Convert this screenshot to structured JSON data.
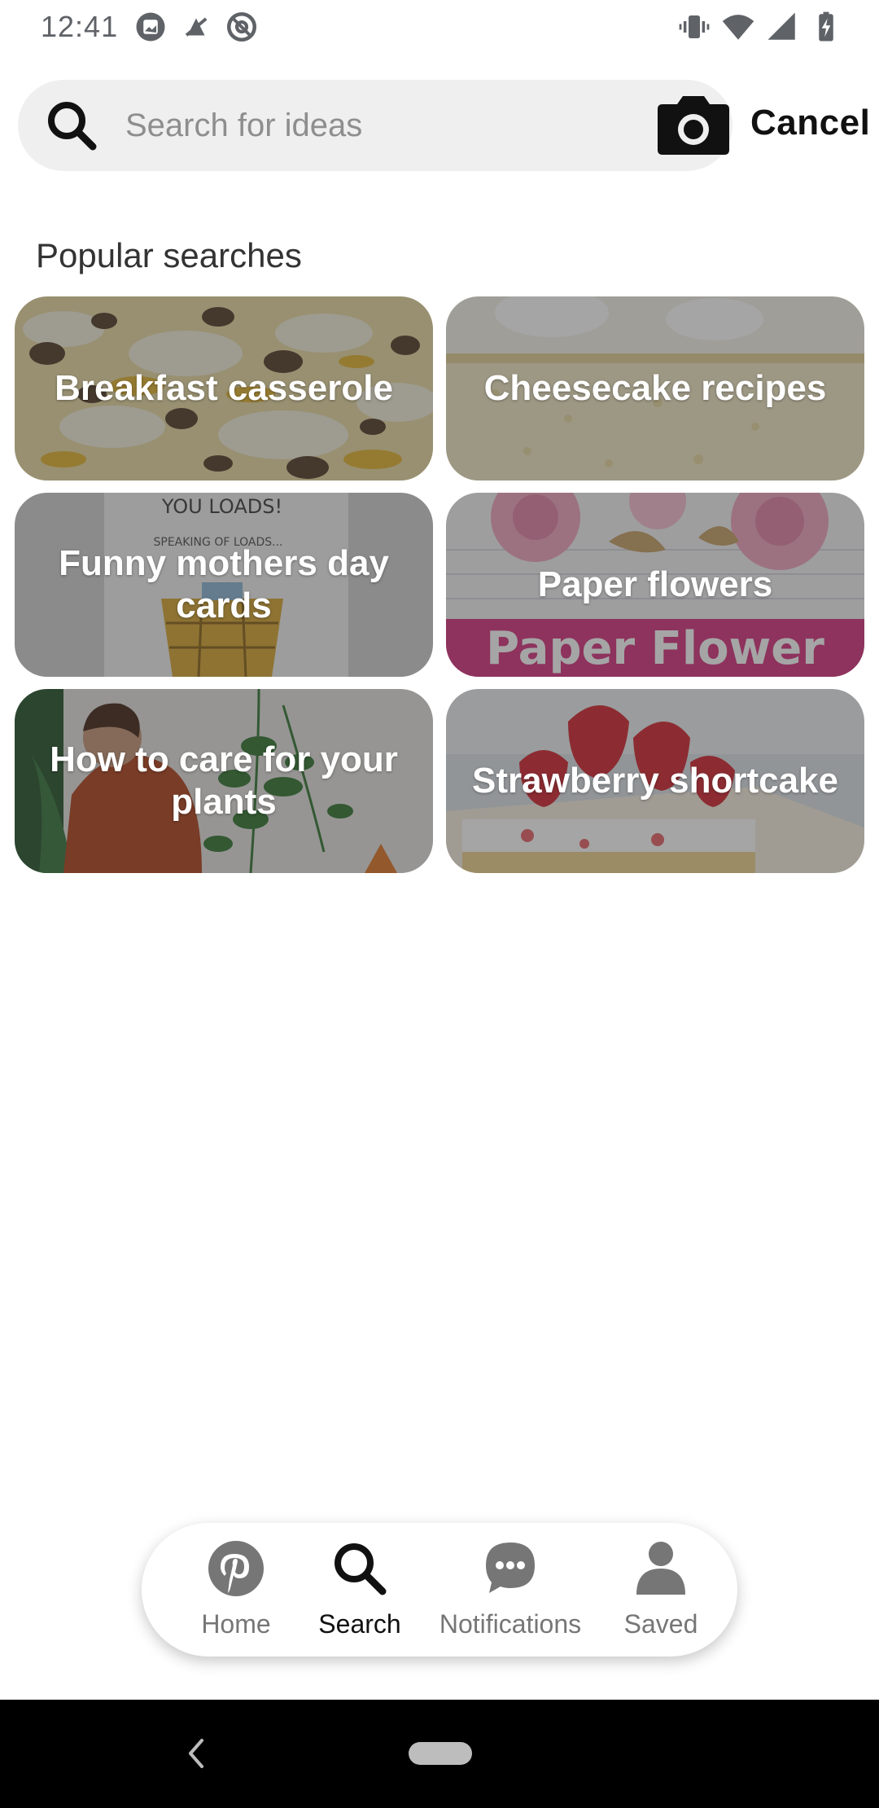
{
  "status_bar": {
    "time": "12:41",
    "left_icons": [
      "image-icon",
      "no-wifi-icon",
      "at-sign-icon"
    ],
    "right_icons": [
      "vibrate-icon",
      "wifi-icon",
      "signal-icon",
      "battery-charging-icon"
    ]
  },
  "search": {
    "placeholder": "Search for ideas",
    "value": "",
    "cancel_label": "Cancel"
  },
  "popular": {
    "title": "Popular searches",
    "tiles": [
      {
        "label": "Breakfast casserole"
      },
      {
        "label": "Cheesecake recipes"
      },
      {
        "label": "Funny mothers day cards",
        "image_text_line1": "YOU LOADS!",
        "image_text_line2": "SPEAKING OF LOADS..."
      },
      {
        "label": "Paper flowers",
        "image_text": "Paper Flower"
      },
      {
        "label": "How to care for your plants"
      },
      {
        "label": "Strawberry shortcake"
      }
    ]
  },
  "bottom_nav": {
    "items": [
      {
        "label": "Home",
        "icon": "pinterest-icon",
        "active": false
      },
      {
        "label": "Search",
        "icon": "search-icon",
        "active": true
      },
      {
        "label": "Notifications",
        "icon": "chat-bubble-icon",
        "active": false
      },
      {
        "label": "Saved",
        "icon": "person-icon",
        "active": false
      }
    ]
  },
  "colors": {
    "accent": "#111111",
    "inactive": "#767676",
    "search_bg": "#efefef"
  }
}
